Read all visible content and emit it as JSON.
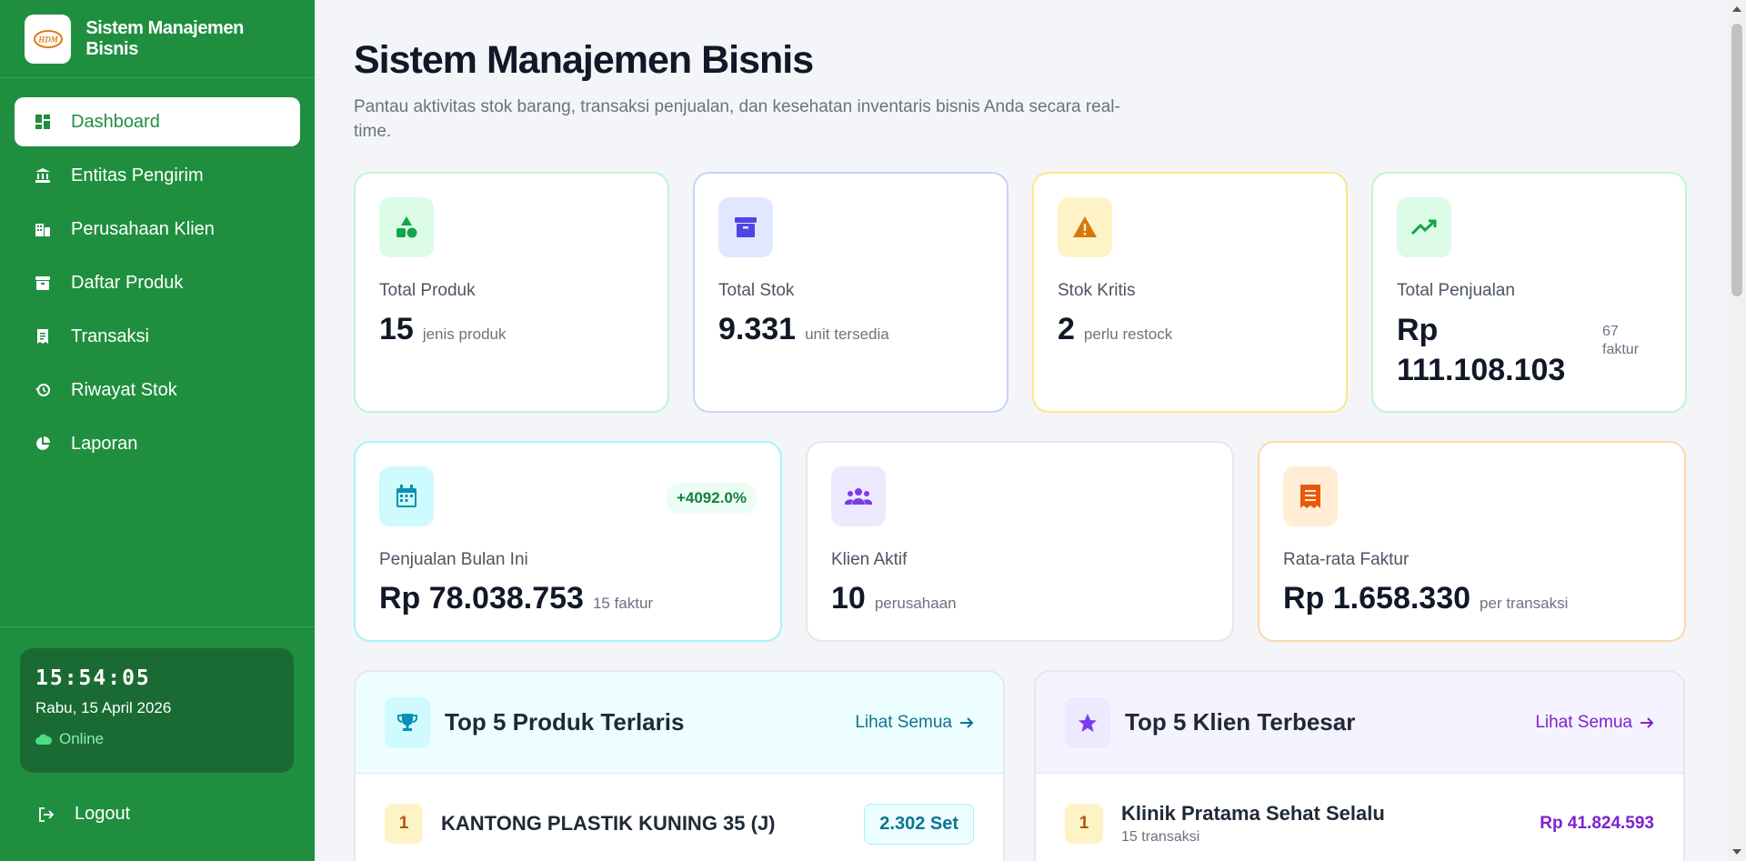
{
  "sidebar": {
    "brand": "Sistem Manajemen Bisnis",
    "logo_text": "HDM",
    "items": [
      {
        "label": "Dashboard",
        "icon": "dashboard-icon",
        "active": true
      },
      {
        "label": "Entitas Pengirim",
        "icon": "bank-icon"
      },
      {
        "label": "Perusahaan Klien",
        "icon": "building-icon"
      },
      {
        "label": "Daftar Produk",
        "icon": "archive-icon"
      },
      {
        "label": "Transaksi",
        "icon": "receipt-icon"
      },
      {
        "label": "Riwayat Stok",
        "icon": "history-icon"
      },
      {
        "label": "Laporan",
        "icon": "pie-chart-icon"
      }
    ],
    "clock": {
      "time": "15:54:05",
      "date": "Rabu, 15 April 2026",
      "status": "Online"
    },
    "logout": "Logout"
  },
  "header": {
    "title": "Sistem Manajemen Bisnis",
    "subtitle": "Pantau aktivitas stok barang, transaksi penjualan, dan kesehatan inventaris bisnis Anda secara real-time."
  },
  "stats_row1": [
    {
      "label": "Total Produk",
      "value": "15",
      "unit": "jenis produk",
      "icon": "shapes-icon",
      "accent": "#16a34a",
      "bg": "#dcfce7",
      "border": "#bbf7d0"
    },
    {
      "label": "Total Stok",
      "value": "9.331",
      "unit": "unit tersedia",
      "icon": "box-icon",
      "accent": "#4f46e5",
      "bg": "#e0e7ff",
      "border": "#c7d2fe"
    },
    {
      "label": "Stok Kritis",
      "value": "2",
      "unit": "perlu restock",
      "icon": "warning-icon",
      "accent": "#d97706",
      "bg": "#fef3c7",
      "border": "#fde68a"
    },
    {
      "label": "Total Penjualan",
      "value": "Rp 111.108.103",
      "unit": "67 faktur",
      "icon": "trending-up-icon",
      "accent": "#16a34a",
      "bg": "#dcfce7",
      "border": "#bbf7d0"
    }
  ],
  "stats_row2": [
    {
      "label": "Penjualan Bulan Ini",
      "value": "Rp 78.038.753",
      "unit": "15 faktur",
      "badge": "+4092.0%",
      "icon": "calendar-icon",
      "accent": "#0891b2",
      "bg": "#cffafe",
      "border": "#a5f3fc"
    },
    {
      "label": "Klien Aktif",
      "value": "10",
      "unit": "perusahaan",
      "icon": "users-icon",
      "accent": "#7c3aed",
      "bg": "#ede9fe",
      "border": "#e5e7eb"
    },
    {
      "label": "Rata-rata Faktur",
      "value": "Rp 1.658.330",
      "unit": "per transaksi",
      "icon": "invoice-icon",
      "accent": "#ea580c",
      "bg": "#ffedd5",
      "border": "#fed7aa"
    }
  ],
  "top_products": {
    "title": "Top 5 Produk Terlaris",
    "link": "Lihat Semua",
    "rows": [
      {
        "rank": "1",
        "name": "KANTONG PLASTIK KUNING 35 (J)",
        "qty": "2.302 Set"
      }
    ]
  },
  "top_clients": {
    "title": "Top 5 Klien Terbesar",
    "link": "Lihat Semua",
    "rows": [
      {
        "rank": "1",
        "name": "Klinik Pratama Sehat Selalu",
        "sub": "15 transaksi",
        "amount": "Rp 41.824.593"
      }
    ]
  }
}
